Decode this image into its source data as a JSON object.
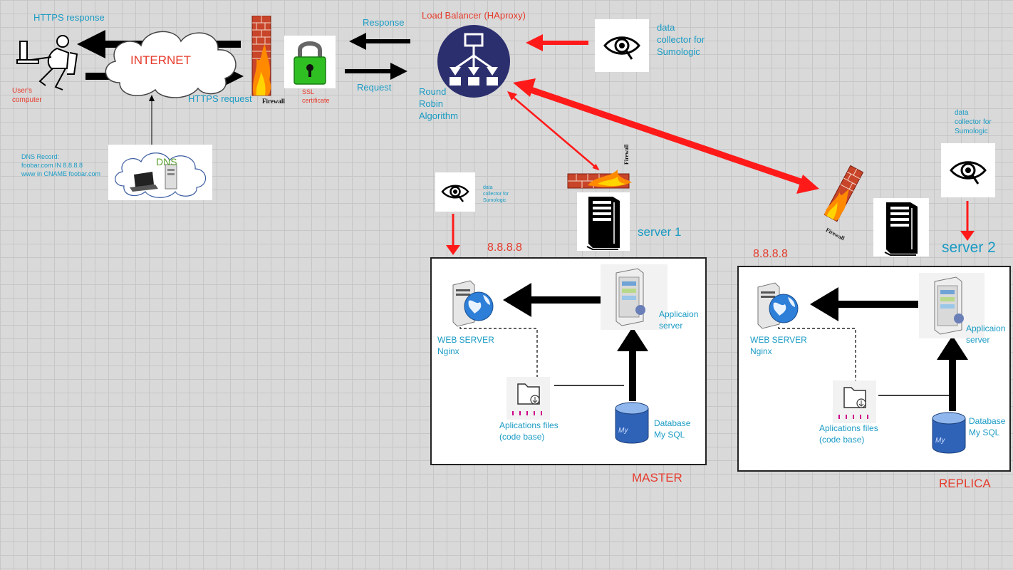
{
  "user": {
    "label_line1": "User's",
    "label_line2": "computer"
  },
  "internet": {
    "label": "INTERNET"
  },
  "labels": {
    "https_response": "HTTPS response",
    "https_request": "HTTPS request",
    "response": "Response",
    "request": "Request",
    "firewall": "Firewall",
    "ssl_line1": "SSL",
    "ssl_line2": "certificate"
  },
  "load_balancer": {
    "title": "Load Balancer (HAproxy)",
    "algo_line1": "Round",
    "algo_line2": "Robin",
    "algo_line3": "Algorithm"
  },
  "collector_top": {
    "line1": "data",
    "line2": "collector for",
    "line3": "Sumologic"
  },
  "collector_right": {
    "line1": "data",
    "line2": "collector for",
    "line3": "Sumologic"
  },
  "collector_mid": {
    "line1": "data",
    "line2": "collector for",
    "line3": "Sumologic"
  },
  "dns": {
    "label": "DNS",
    "record_line1": "DNS Record:",
    "record_line2": "foobar.com  IN 8.8.8.8",
    "record_line3": "www in CNAME foobar.com"
  },
  "server1": {
    "label": "server 1",
    "ip": "8.8.8.8",
    "role": "MASTER",
    "web_line1": "WEB SERVER",
    "web_line2": "Nginx",
    "app_line1": "Applicaion",
    "app_line2": "server",
    "files_line1": "Aplications files",
    "files_line2": "(code base)",
    "db_line1": "Database",
    "db_line2": "My SQL",
    "mysql_logo": "My"
  },
  "server2": {
    "label": "server 2",
    "ip": "8.8.8.8",
    "role": "REPLICA",
    "web_line1": "WEB SERVER",
    "web_line2": "Nginx",
    "app_line1": "Applicaion",
    "app_line2": "server",
    "files_line1": "Aplications files",
    "files_line2": "(code base)",
    "db_line1": "Database",
    "db_line2": "My SQL",
    "mysql_logo": "My"
  },
  "colors": {
    "teal": "#1a9bc4",
    "red": "#e53b2c",
    "arrow_red": "#ff1a1a",
    "lb_navy": "#2c2f6e"
  }
}
